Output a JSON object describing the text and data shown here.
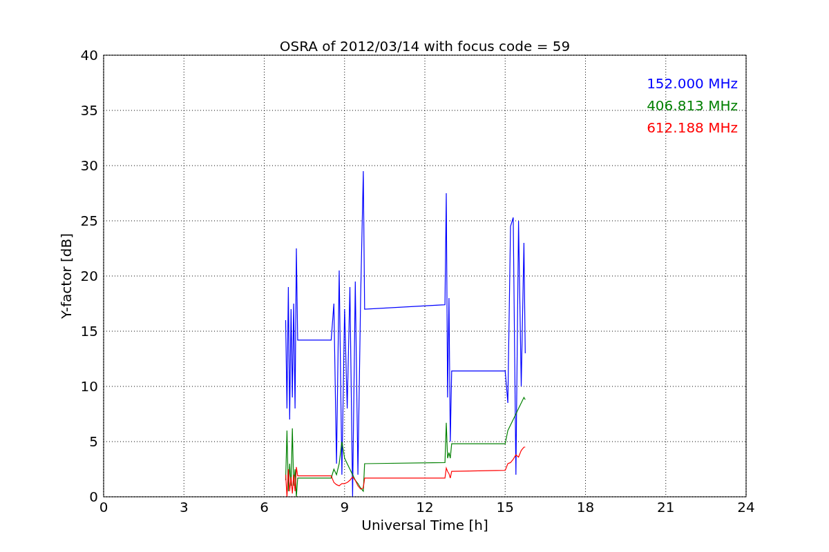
{
  "chart_data": {
    "type": "line",
    "title": "OSRA of 2012/03/14 with focus code = 59",
    "xlabel": "Universal Time [h]",
    "ylabel": "Y-factor [dB]",
    "x": [
      6.8,
      6.85,
      6.9,
      6.95,
      7.0,
      7.05,
      7.1,
      7.15,
      7.2,
      7.25,
      8.5,
      8.6,
      8.7,
      8.8,
      8.9,
      9.0,
      9.1,
      9.2,
      9.3,
      9.4,
      9.5,
      9.6,
      9.7,
      9.75,
      12.75,
      12.8,
      12.85,
      12.9,
      12.95,
      13.0,
      15.0,
      15.1,
      15.2,
      15.3,
      15.4,
      15.5,
      15.6,
      15.7,
      15.75
    ],
    "series": [
      {
        "name": "152.000 MHz",
        "color": "#0000ff",
        "values": [
          16,
          8,
          19,
          7,
          17,
          9,
          17.5,
          8,
          22.5,
          14.2,
          14.2,
          17.5,
          3,
          20.5,
          2,
          17,
          8,
          19,
          0,
          19.5,
          2,
          18,
          29.5,
          17,
          17.4,
          27.5,
          9,
          18,
          5,
          11.4,
          11.4,
          8.5,
          24.5,
          25.3,
          2,
          25,
          10,
          23,
          13
        ]
      },
      {
        "name": "406.813 MHz",
        "color": "#008000",
        "values": [
          1.5,
          6,
          0.5,
          3,
          1,
          6.2,
          1,
          2.5,
          0,
          1.7,
          1.7,
          2.5,
          2,
          3,
          5,
          3.5,
          3,
          2.5,
          2,
          1.5,
          1.2,
          0.8,
          0.5,
          3,
          3.1,
          6.7,
          3.5,
          4,
          3.5,
          4.8,
          4.8,
          6,
          6.5,
          7,
          7.5,
          8,
          8.5,
          9,
          8.8
        ]
      },
      {
        "name": "612.188 MHz",
        "color": "#ff0000",
        "values": [
          2,
          0,
          2.5,
          0.5,
          1.8,
          0.3,
          2,
          0.5,
          2.7,
          1.9,
          1.9,
          1.3,
          1.1,
          1,
          1.2,
          1.2,
          1.3,
          1.5,
          1.8,
          1.5,
          1,
          0.7,
          0.8,
          1.7,
          1.7,
          2.6,
          2.3,
          2.1,
          1.7,
          2.3,
          2.4,
          3,
          3.1,
          3.4,
          3.8,
          3.6,
          4.2,
          4.5,
          4.5
        ]
      }
    ],
    "xlim": [
      0,
      24
    ],
    "ylim": [
      0,
      40
    ],
    "xticks": [
      0,
      3,
      6,
      9,
      12,
      15,
      18,
      21,
      24
    ],
    "yticks": [
      0,
      5,
      10,
      15,
      20,
      25,
      30,
      35,
      40
    ],
    "grid": true
  }
}
